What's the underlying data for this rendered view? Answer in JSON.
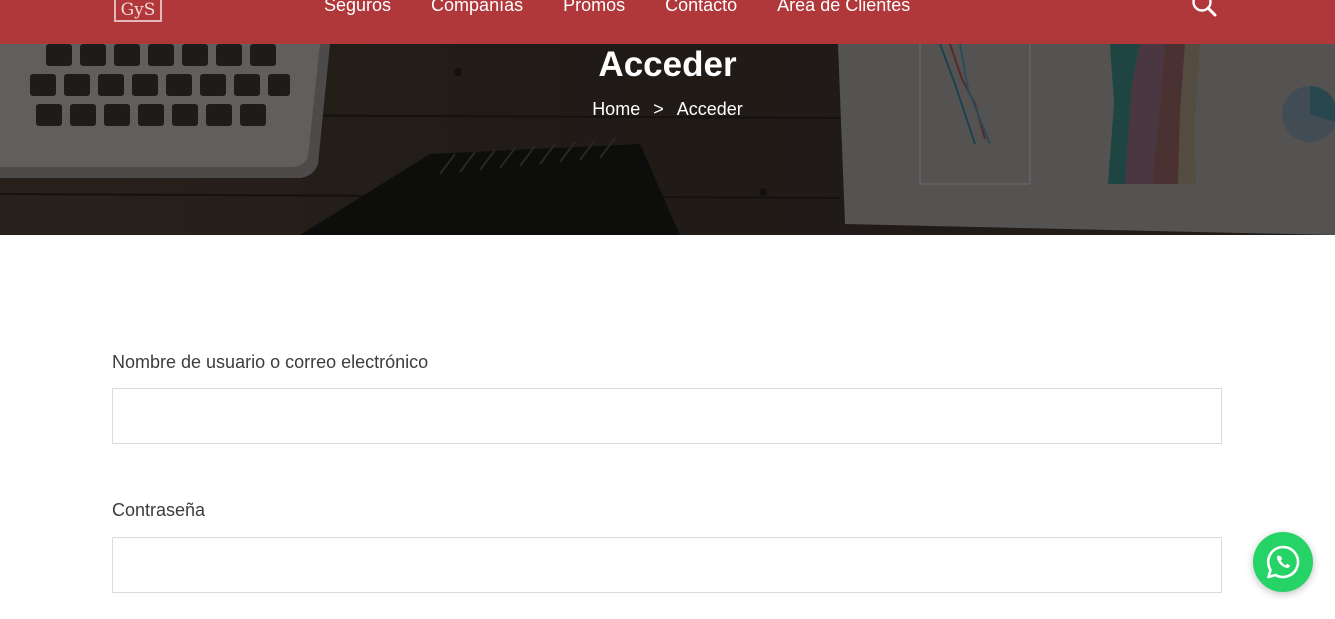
{
  "header": {
    "logo_text": "GyS",
    "nav": [
      {
        "label": "Seguros"
      },
      {
        "label": "Compañías"
      },
      {
        "label": "Promos"
      },
      {
        "label": "Contacto"
      },
      {
        "label": "Área de Clientes"
      }
    ],
    "search_icon": "search-icon"
  },
  "hero": {
    "title": "Acceder",
    "breadcrumb": {
      "home": "Home",
      "separator": ">",
      "current": "Acceder"
    }
  },
  "form": {
    "username_label": "Nombre de usuario o correo electrónico",
    "username_value": "",
    "password_label": "Contraseña",
    "password_value": ""
  },
  "floating": {
    "whatsapp_icon": "whatsapp-icon"
  },
  "colors": {
    "header_bg": "#b0373a",
    "whatsapp": "#25d366",
    "text": "#3c3c3c"
  }
}
